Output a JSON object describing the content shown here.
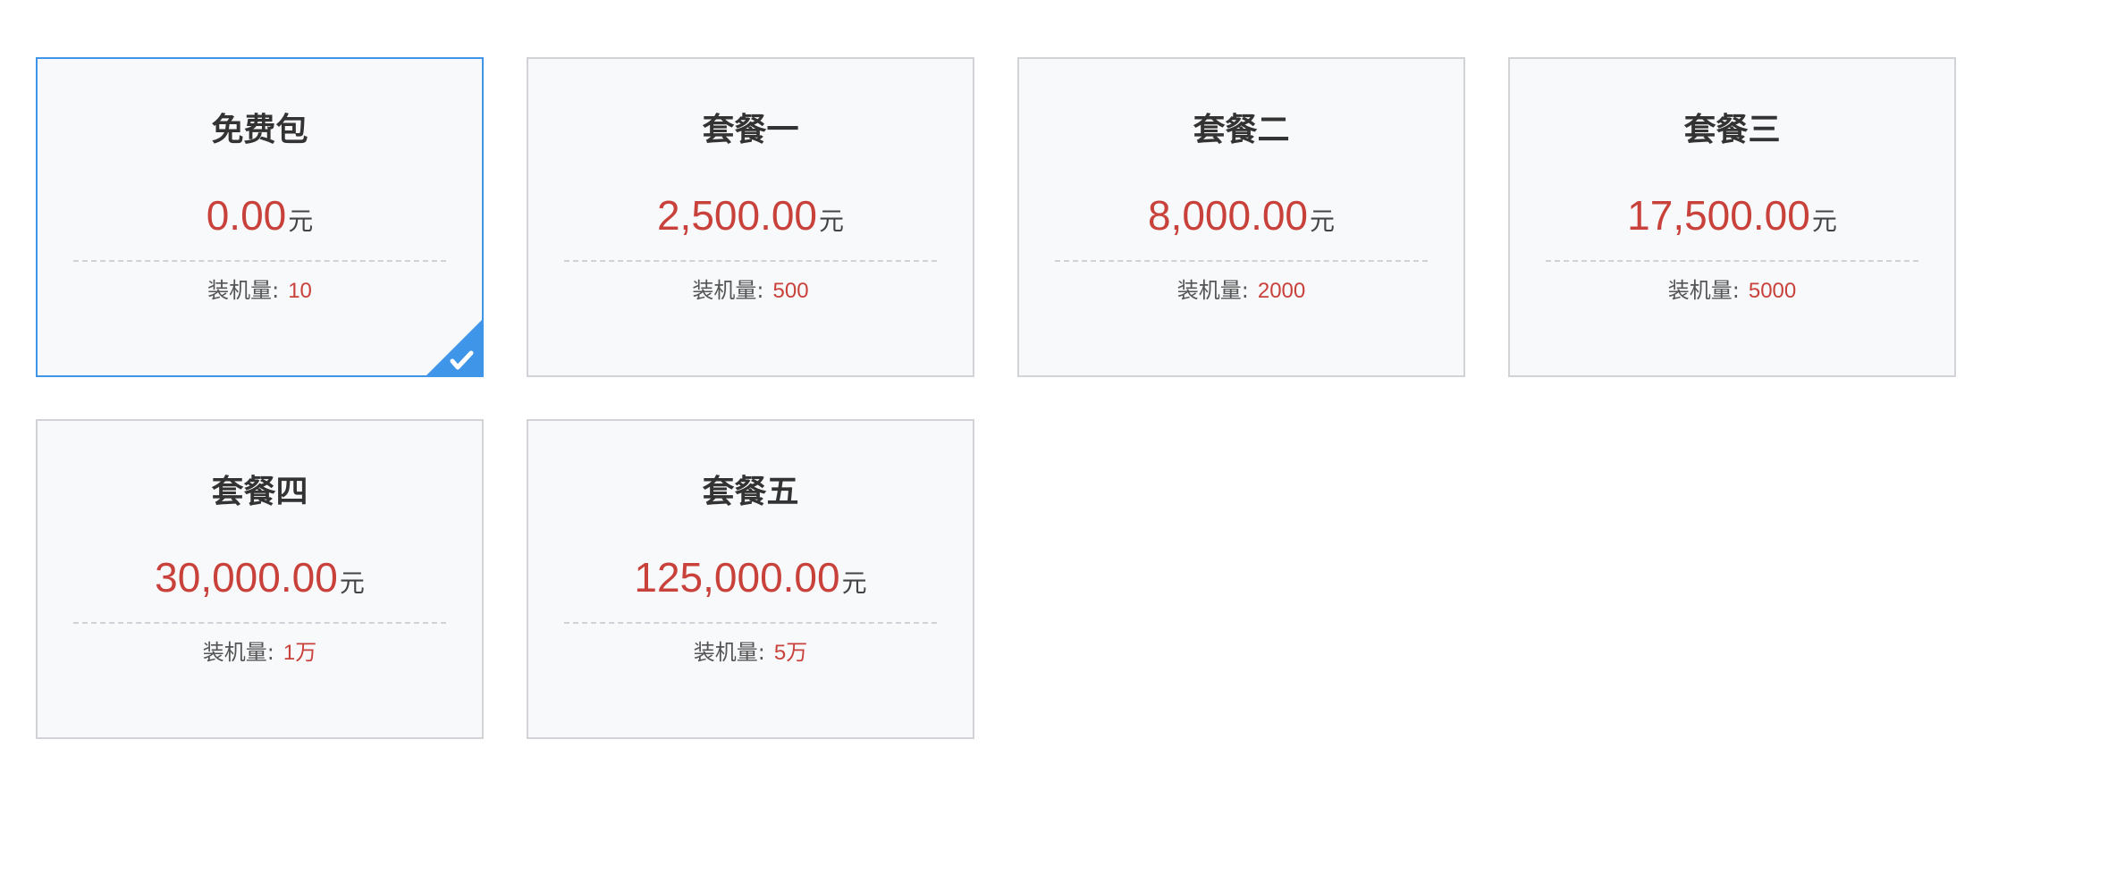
{
  "accent_color": "#3f95e8",
  "price_color": "#c9413b",
  "packages": [
    {
      "title": "免费包",
      "price": "0.00",
      "unit": "元",
      "install_label": "装机量:",
      "install_value": "10",
      "selected": true
    },
    {
      "title": "套餐一",
      "price": "2,500.00",
      "unit": "元",
      "install_label": "装机量:",
      "install_value": "500",
      "selected": false
    },
    {
      "title": "套餐二",
      "price": "8,000.00",
      "unit": "元",
      "install_label": "装机量:",
      "install_value": "2000",
      "selected": false
    },
    {
      "title": "套餐三",
      "price": "17,500.00",
      "unit": "元",
      "install_label": "装机量:",
      "install_value": "5000",
      "selected": false
    },
    {
      "title": "套餐四",
      "price": "30,000.00",
      "unit": "元",
      "install_label": "装机量:",
      "install_value": "1万",
      "selected": false
    },
    {
      "title": "套餐五",
      "price": "125,000.00",
      "unit": "元",
      "install_label": "装机量:",
      "install_value": "5万",
      "selected": false
    }
  ],
  "selected_indicator_icon": "check-icon"
}
